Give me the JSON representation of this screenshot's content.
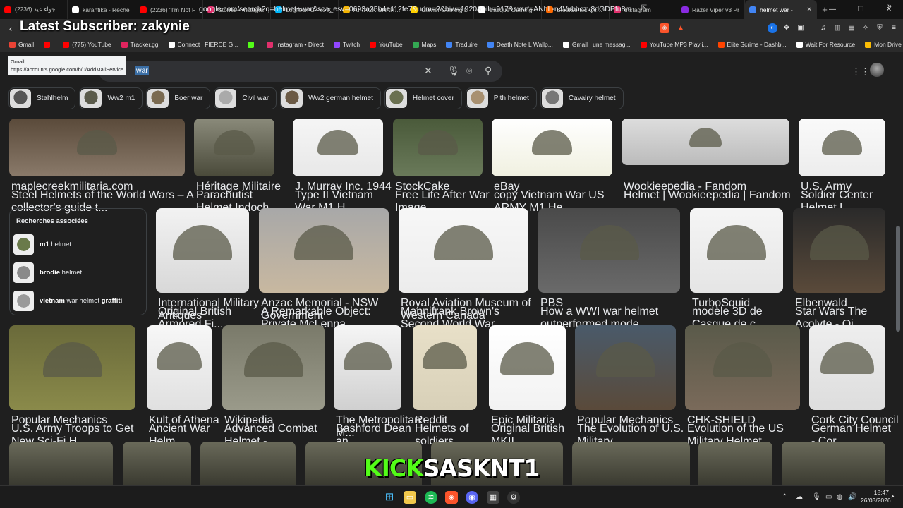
{
  "tabs": [
    {
      "label": "اجواء عيد (2236)",
      "color": "#ff0000"
    },
    {
      "label": "karantika - Reche",
      "color": "#ffffff"
    },
    {
      "label": "(2236) \"I'm Not F",
      "color": "#ff0000"
    },
    {
      "label": "Stories • Instagra",
      "color": "#e1306c"
    },
    {
      "label": "Logitech G Pro X",
      "color": "#00b8fc"
    },
    {
      "label": "ATTACK SHARK X",
      "color": "#f4b400"
    },
    {
      "label": "Clavier Gaming L",
      "color": "#ffd000"
    },
    {
      "label": "Casque Gaming",
      "color": "#ffffff"
    },
    {
      "label": "SteelSeries QcK H",
      "color": "#ff6a00"
    },
    {
      "label": "Instagram",
      "color": "#e1306c"
    },
    {
      "label": "Razer Viper v3 Pr",
      "color": "#8a2be2"
    },
    {
      "label": "helmet war -",
      "color": "#4285f4",
      "active": true
    }
  ],
  "address": {
    "url": "google.com/search?q=helmet+war&sca_esv=0693a25b4e112fe7&udm=2&biw=1920&bih=917&sxsrf=ANbL-n4Vubhczv8dGDPfu8mm9xhrW3lljw%...",
    "overlay_title": "Latest Subscriber: zakynie"
  },
  "bookmarks": [
    {
      "label": "Gmail",
      "color": "#ea4335"
    },
    {
      "label": "",
      "color": "#ff0000"
    },
    {
      "label": "(775) YouTube",
      "color": "#ff0000"
    },
    {
      "label": "Tracker.gg",
      "color": "#e0245e"
    },
    {
      "label": "Connect | FIERCE G...",
      "color": "#ffffff"
    },
    {
      "label": "",
      "color": "#53fc18"
    },
    {
      "label": "Instagram • Direct",
      "color": "#e1306c"
    },
    {
      "label": "Twitch",
      "color": "#9146ff"
    },
    {
      "label": "YouTube",
      "color": "#ff0000"
    },
    {
      "label": "Maps",
      "color": "#34a853"
    },
    {
      "label": "Traduire",
      "color": "#4285f4"
    },
    {
      "label": "Death Note L Wallp...",
      "color": "#4285f4"
    },
    {
      "label": "Gmail : une messag...",
      "color": "#ffffff"
    },
    {
      "label": "YouTube MP3 Playli...",
      "color": "#ff0000"
    },
    {
      "label": "Elite Scrims - Dashb...",
      "color": "#ff4400"
    },
    {
      "label": "Wait For Resource",
      "color": "#ffffff"
    },
    {
      "label": "Mon Drive - Google...",
      "color": "#fbbc04"
    }
  ],
  "tooltip": {
    "title": "Gmail",
    "url": "https://accounts.google.com/b/0/AddMailService"
  },
  "search": {
    "query": "war"
  },
  "chips": [
    {
      "label": "Stahlhelm",
      "color": "#555"
    },
    {
      "label": "Ww2 m1",
      "color": "#5a5a4a"
    },
    {
      "label": "Boer war",
      "color": "#7a6a50"
    },
    {
      "label": "Civil war",
      "color": "#aaaaaa"
    },
    {
      "label": "Ww2 german helmet",
      "color": "#6b5a45"
    },
    {
      "label": "Helmet cover",
      "color": "#6a7050"
    },
    {
      "label": "Pith helmet",
      "color": "#a89070"
    },
    {
      "label": "Cavalry helmet",
      "color": "#777777"
    }
  ],
  "row1": [
    {
      "source": "maplecreekmilitaria.com",
      "title": "Steel Helmets of the World Wars – A collector's guide t...",
      "fav": "#4285f4"
    },
    {
      "source": "Héritage Militaire",
      "title": "Parachutist Helmet Indoch...",
      "fav": "#999"
    },
    {
      "source": "J. Murray Inc. 1944",
      "title": "Type II Vietnam War M1 H...",
      "fav": "#888"
    },
    {
      "source": "StockCake",
      "title": "Free Life After War Image ...",
      "fav": "#00a86b"
    },
    {
      "source": "eBay",
      "title": "copy Vietnam War US ARMY M1 He...",
      "fav": "#e53238"
    },
    {
      "source": "Wookieepedia - Fandom",
      "title": "Helmet | Wookieepedia | Fandom",
      "fav": "#444"
    },
    {
      "source": "U.S. Army",
      "title": "Soldier Center Helmet L...",
      "fav": "#f4c20d"
    }
  ],
  "related": {
    "heading": "Recherches associées",
    "items": [
      {
        "bold": "m1",
        "rest": " helmet",
        "bold2": ""
      },
      {
        "bold": "brodie",
        "rest": " helmet",
        "bold2": ""
      },
      {
        "bold": "vietnam",
        "rest": " war helmet ",
        "bold2": "graffiti"
      }
    ]
  },
  "row2": [
    {
      "source": "International Military Antiques",
      "title": "Original British Armored Fi...",
      "fav": "#777"
    },
    {
      "source": "Anzac Memorial - NSW Government",
      "title": "A Remarkable Object: Private McLenna...",
      "fav": "#b88a3a"
    },
    {
      "source": "Royal Aviation Museum of Western Canada",
      "title": "Mannifrank Brown's Second World War ...",
      "fav": "#4a6fa5"
    },
    {
      "source": "PBS",
      "title": "How a WWI war helmet outperformed mode...",
      "fav": "#2638c4"
    },
    {
      "source": "TurboSquid",
      "title": "modèle 3D de Casque de c...",
      "fav": "#f68b1f"
    },
    {
      "source": "Elbenwald",
      "title": "Star Wars The Acolyte - Qi...",
      "fav": "#3a3a3a"
    }
  ],
  "row3": [
    {
      "source": "Popular Mechanics",
      "title": "U.S. Army Troops to Get New Sci-Fi H...",
      "fav": "#1a73e8"
    },
    {
      "source": "Kult of Athena",
      "title": "Ancient War Helm...",
      "fav": "#a6781b"
    },
    {
      "source": "Wikipedia",
      "title": "Advanced Combat Helmet - ...",
      "fav": "#eeeeee"
    },
    {
      "source": "The Metropolitan M...",
      "title": "Bashford Dean an...",
      "fav": "#e4002b"
    },
    {
      "source": "Reddit",
      "title": "Helmets of soldiers...",
      "fav": "#ff4500"
    },
    {
      "source": "Epic Militaria",
      "title": "Original British MKII ...",
      "fav": "#555"
    },
    {
      "source": "Popular Mechanics",
      "title": "The Evolution of U.S. Military ...",
      "fav": "#1a73e8"
    },
    {
      "source": "CHK-SHIELD",
      "title": "Evolution of the US Military Helmet",
      "fav": "#222"
    },
    {
      "source": "Cork City Council",
      "title": "German Helmet - Cor...",
      "fav": "#2a6f3c"
    }
  ],
  "stream_overlay": {
    "part1": "KICK",
    "part2": "SASKNT1"
  },
  "clock": {
    "time": "18:47",
    "date": "26/03/2026"
  }
}
